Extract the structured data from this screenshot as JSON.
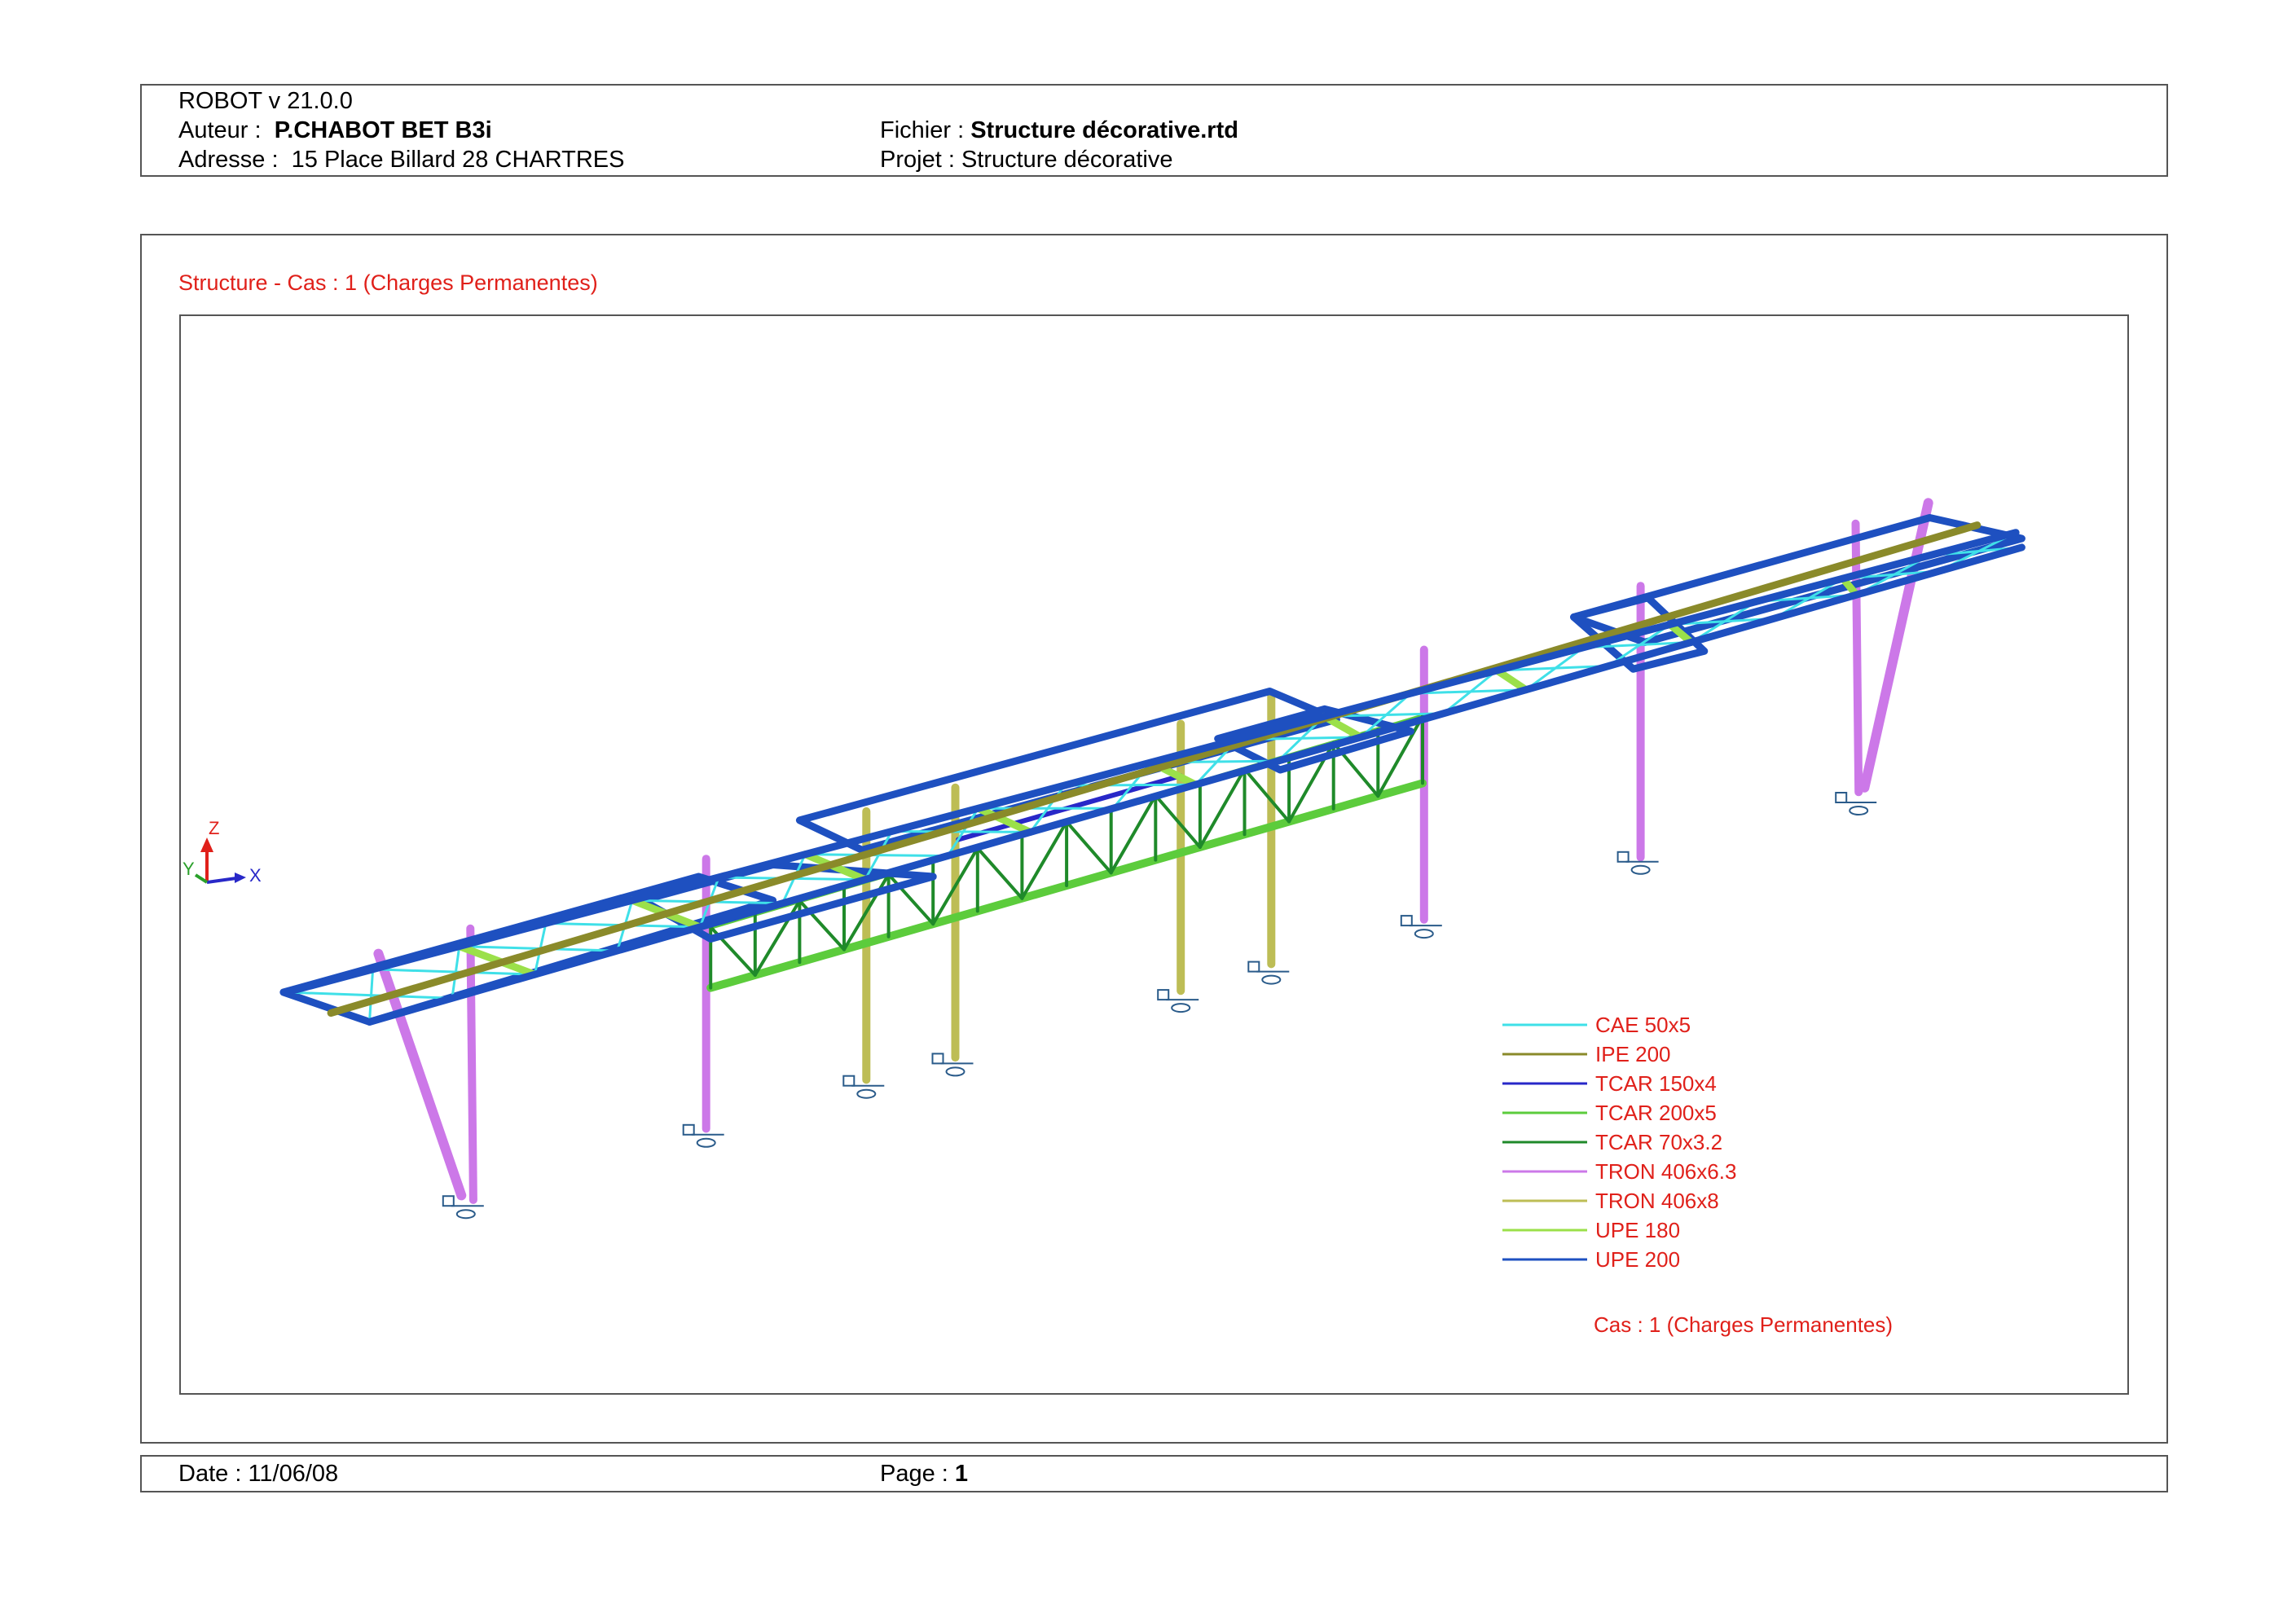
{
  "header": {
    "software": "ROBOT v 21.0.0",
    "author_label": "Auteur :",
    "author_value": "P.CHABOT BET B3i",
    "address_label": "Adresse :",
    "address_value": "15 Place Billard 28 CHARTRES",
    "file_label": "Fichier :",
    "file_value": "Structure décorative.rtd",
    "project_label": "Projet :",
    "project_value": "Structure décorative"
  },
  "drawing": {
    "title": "Structure - Cas : 1 (Charges Permanentes)",
    "case_label": "Cas : 1 (Charges Permanentes)",
    "axes": {
      "z": "Z",
      "y": "Y",
      "x": "X"
    },
    "legend": [
      {
        "label": "CAE 50x5",
        "color": "#3fe0e8"
      },
      {
        "label": "IPE 200",
        "color": "#8a8a2a"
      },
      {
        "label": "TCAR 150x4",
        "color": "#2828c8"
      },
      {
        "label": "TCAR 200x5",
        "color": "#5ccc3c"
      },
      {
        "label": "TCAR 70x3.2",
        "color": "#1f8a2a"
      },
      {
        "label": "TRON 406x6.3",
        "color": "#cc78e8"
      },
      {
        "label": "TRON 406x8",
        "color": "#bdbd55"
      },
      {
        "label": "UPE 180",
        "color": "#9be04a"
      },
      {
        "label": "UPE 200",
        "color": "#1e50c0"
      }
    ]
  },
  "footer": {
    "date_label": "Date :",
    "date_value": "11/06/08",
    "page_label": "Page :",
    "page_value": "1"
  }
}
